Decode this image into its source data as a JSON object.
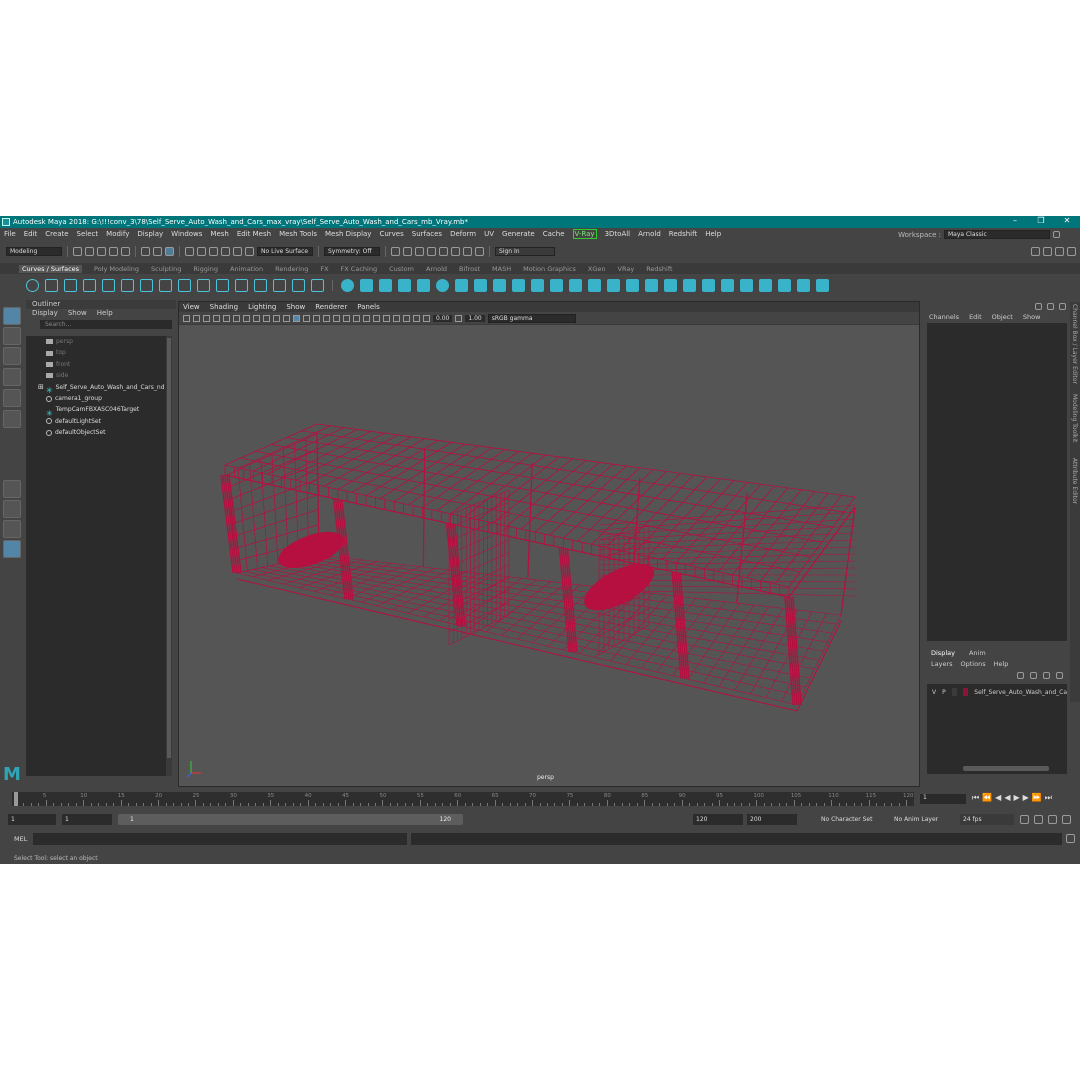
{
  "window": {
    "title": "Autodesk Maya 2018: G:\\!!!conv_3\\78\\Self_Serve_Auto_Wash_and_Cars_max_vray\\Self_Serve_Auto_Wash_and_Cars_mb_Vray.mb*",
    "minimize": "–",
    "maximize": "❐",
    "close": "✕"
  },
  "menubar": [
    "File",
    "Edit",
    "Create",
    "Select",
    "Modify",
    "Display",
    "Windows",
    "Mesh",
    "Edit Mesh",
    "Mesh Tools",
    "Mesh Display",
    "Curves",
    "Surfaces",
    "Deform",
    "UV",
    "Generate",
    "Cache",
    "V-Ray",
    "3DtoAll",
    "Arnold",
    "Redshift",
    "Help"
  ],
  "workspace": {
    "label": "Workspace :",
    "value": "Maya Classic"
  },
  "statusline": {
    "mode": "Modeling",
    "live_surface": "No Live Surface",
    "symmetry": "Symmetry: Off",
    "sign_in": "Sign In"
  },
  "shelf_tabs": [
    "Curves / Surfaces",
    "Poly Modeling",
    "Sculpting",
    "Rigging",
    "Animation",
    "Rendering",
    "FX",
    "FX Caching",
    "Custom",
    "Arnold",
    "Bifrost",
    "MASH",
    "Motion Graphics",
    "XGen",
    "VRay",
    "Redshift"
  ],
  "outliner": {
    "title": "Outliner",
    "menu": [
      "Display",
      "Show",
      "Help"
    ],
    "search_placeholder": "Search...",
    "items": [
      {
        "label": "persp",
        "kind": "camera",
        "dim": true
      },
      {
        "label": "top",
        "kind": "camera",
        "dim": true
      },
      {
        "label": "front",
        "kind": "camera",
        "dim": true
      },
      {
        "label": "side",
        "kind": "camera",
        "dim": true
      },
      {
        "label": "Self_Serve_Auto_Wash_and_Cars_nd",
        "kind": "group",
        "dim": false
      },
      {
        "label": "camera1_group",
        "kind": "set",
        "dim": false
      },
      {
        "label": "TempCamFBXASC046Target",
        "kind": "group",
        "dim": false
      },
      {
        "label": "defaultLightSet",
        "kind": "set",
        "dim": false
      },
      {
        "label": "defaultObjectSet",
        "kind": "set",
        "dim": false
      }
    ]
  },
  "viewport": {
    "menu": [
      "View",
      "Shading",
      "Lighting",
      "Show",
      "Renderer",
      "Panels"
    ],
    "exposure": "0.00",
    "gamma": "1.00",
    "color_space": "sRGB gamma",
    "camera": "persp",
    "wire_color": "#b5103f"
  },
  "channel_box": {
    "menu": [
      "Channels",
      "Edit",
      "Object",
      "Show"
    ]
  },
  "layer_editor": {
    "tabs": [
      "Display",
      "Anim"
    ],
    "menu": [
      "Layers",
      "Options",
      "Help"
    ],
    "layer": {
      "v": "V",
      "p": "P",
      "name": "Self_Serve_Auto_Wash_and_Ca",
      "color": "#8b1538"
    }
  },
  "side_tabs": [
    "Channel Box / Layer Editor",
    "Modeling Toolkit",
    "Attribute Editor"
  ],
  "timeline": {
    "ticks": [
      "5",
      "10",
      "15",
      "20",
      "25",
      "30",
      "35",
      "40",
      "45",
      "50",
      "55",
      "60",
      "65",
      "70",
      "75",
      "80",
      "85",
      "90",
      "95",
      "100",
      "105",
      "110",
      "115",
      "120"
    ],
    "start": 1,
    "end": 120,
    "current_frame": "1"
  },
  "range": {
    "start": "1",
    "playback_start": "1",
    "range_start": "1",
    "range_end": "120",
    "playback_end": "120",
    "end": "200",
    "character_set": "No Character Set",
    "anim_layer": "No Anim Layer",
    "fps": "24 fps"
  },
  "command_line": {
    "label": "MEL"
  },
  "help_line": "Select Tool: select an object"
}
